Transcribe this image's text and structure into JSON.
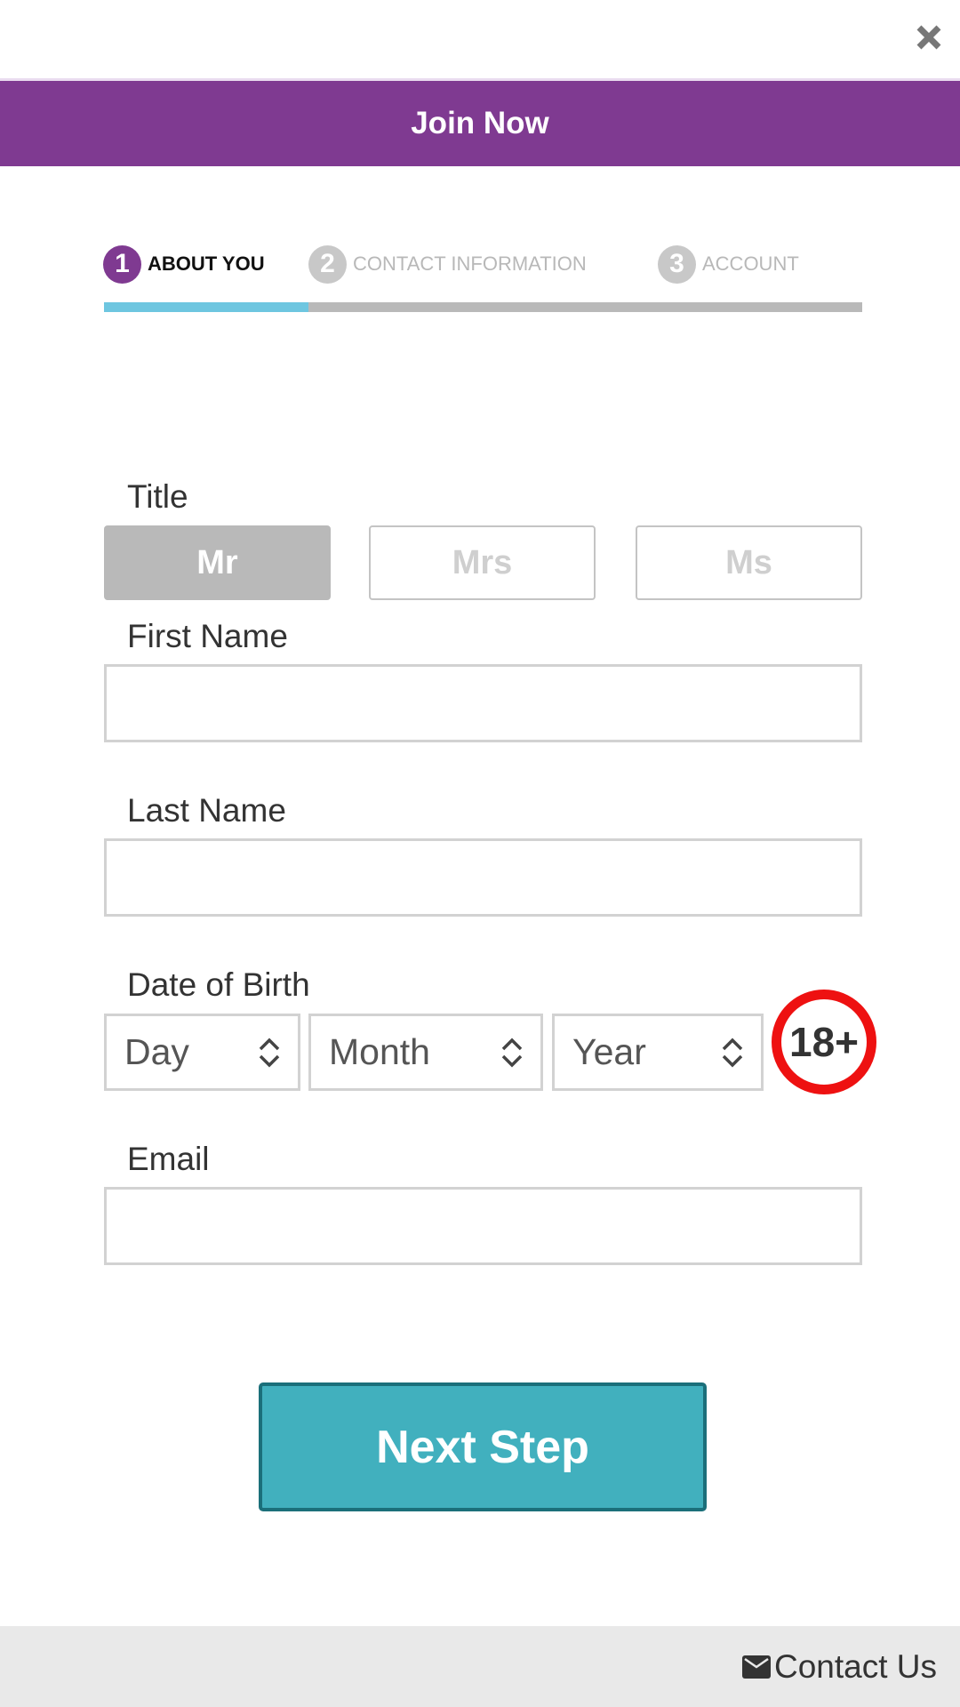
{
  "modal": {
    "close_icon": "close-icon",
    "header_title": "Join Now"
  },
  "steps": [
    {
      "number": "1",
      "label": "ABOUT YOU",
      "state": "active"
    },
    {
      "number": "2",
      "label": "CONTACT INFORMATION",
      "state": "inactive"
    },
    {
      "number": "3",
      "label": "ACCOUNT",
      "state": "inactive"
    }
  ],
  "progress": {
    "percent": 27
  },
  "form": {
    "title": {
      "label": "Title",
      "options": [
        "Mr",
        "Mrs",
        "Ms"
      ],
      "selected": "Mr"
    },
    "first_name": {
      "label": "First Name",
      "value": "",
      "placeholder": ""
    },
    "last_name": {
      "label": "Last Name",
      "value": "",
      "placeholder": ""
    },
    "dob": {
      "label": "Date of Birth",
      "day": "Day",
      "month": "Month",
      "year": "Year",
      "age_badge": "18+"
    },
    "email": {
      "label": "Email",
      "value": "",
      "placeholder": ""
    }
  },
  "actions": {
    "next_label": "Next Step"
  },
  "footer": {
    "contact_label": "Contact Us",
    "contact_icon": "envelope-icon"
  },
  "colors": {
    "brand_purple": "#7f3a91",
    "progress_blue": "#6ec6e0",
    "button_teal": "#41b0be",
    "badge_red": "#ee1111"
  }
}
